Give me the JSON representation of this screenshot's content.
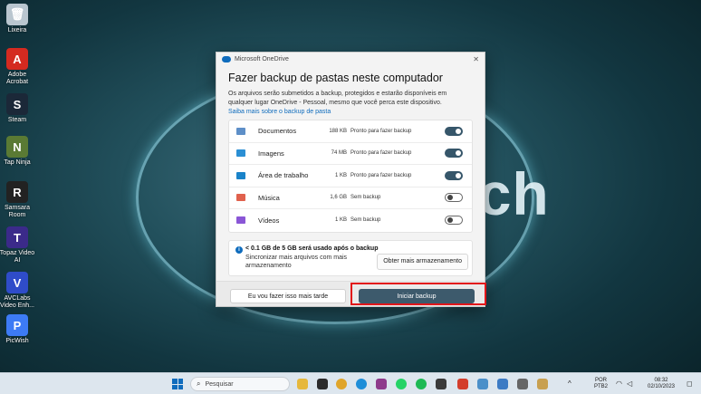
{
  "desktop": {
    "icons": [
      {
        "label": "Lixeira",
        "icon": "recycle-bin-icon",
        "color": "#b9c6cf",
        "glyph": "🗑"
      },
      {
        "label": "Adobe Acrobat",
        "icon": "acrobat-icon",
        "color": "#d42a20",
        "glyph": "A"
      },
      {
        "label": "Steam",
        "icon": "steam-icon",
        "color": "#1b2838",
        "glyph": "S"
      },
      {
        "label": "Tap Ninja",
        "icon": "tap-ninja-icon",
        "color": "#5a7a34",
        "glyph": "N"
      },
      {
        "label": "Samsara Room",
        "icon": "samsara-room-icon",
        "color": "#222222",
        "glyph": "R"
      },
      {
        "label": "Topaz Video AI",
        "icon": "topaz-icon",
        "color": "#3b2a8a",
        "glyph": "T"
      },
      {
        "label": "AVCLabs Video Enh...",
        "icon": "avclabs-icon",
        "color": "#2f4cc9",
        "glyph": "V"
      },
      {
        "label": "PicWish",
        "icon": "picwish-icon",
        "color": "#3d7bf5",
        "glyph": "P"
      }
    ],
    "wallpaper_text": "ech"
  },
  "dialog": {
    "app_title": "Microsoft OneDrive",
    "close_glyph": "✕",
    "heading": "Fazer backup de pastas neste computador",
    "description": "Os arquivos serão submetidos a backup, protegidos e estarão disponíveis em qualquer lugar OneDrive  - Pessoal, mesmo que você perca este dispositivo.",
    "learn_more": "Saiba mais sobre o backup de pasta",
    "folders": [
      {
        "name": "Documentos",
        "size": "188 KB",
        "status": "Pronto para fazer backup",
        "enabled": true,
        "color": "#5e8fc8",
        "icon": "documents-folder-icon"
      },
      {
        "name": "Imagens",
        "size": "74 MB",
        "status": "Pronto para fazer backup",
        "enabled": true,
        "color": "#2b8fd4",
        "icon": "pictures-folder-icon"
      },
      {
        "name": "Área de trabalho",
        "size": "1 KB",
        "status": "Pronto para fazer backup",
        "enabled": true,
        "color": "#1a83c9",
        "icon": "desktop-folder-icon"
      },
      {
        "name": "Música",
        "size": "1,6 GB",
        "status": "Sem backup",
        "enabled": false,
        "color": "#e0614d",
        "icon": "music-folder-icon"
      },
      {
        "name": "Vídeos",
        "size": "1 KB",
        "status": "Sem backup",
        "enabled": false,
        "color": "#8a56d6",
        "icon": "videos-folder-icon"
      }
    ],
    "storage": {
      "title": "< 0.1 GB de 5 GB será usado após o backup",
      "text": "Sincronizar mais arquivos com mais armazenamento",
      "more_storage": "Obter mais armazenamento"
    },
    "later_button": "Eu vou fazer isso mais tarde",
    "start_button": "Iniciar backup"
  },
  "taskbar": {
    "search_placeholder": "Pesquisar",
    "language": "POR",
    "keyboard": "PTB2",
    "time": "08:32",
    "date": "02/10/2023"
  }
}
